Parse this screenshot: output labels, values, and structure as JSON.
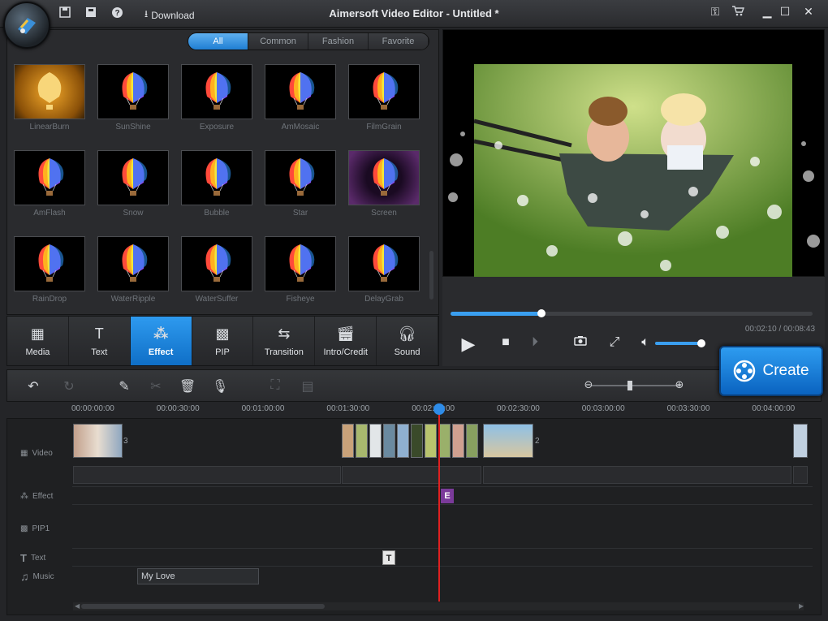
{
  "app": {
    "title": "Aimersoft Video Editor - Untitled *",
    "download_label": "Download"
  },
  "library": {
    "tabs": [
      {
        "label": "All",
        "active": true
      },
      {
        "label": "Common",
        "active": false
      },
      {
        "label": "Fashion",
        "active": false
      },
      {
        "label": "Favorite",
        "active": false
      }
    ],
    "effects": [
      {
        "label": "LinearBurn",
        "style": "gold"
      },
      {
        "label": "SunShine",
        "style": "dark"
      },
      {
        "label": "Exposure",
        "style": "dark"
      },
      {
        "label": "AmMosaic",
        "style": "dark"
      },
      {
        "label": "FilmGrain",
        "style": "dark"
      },
      {
        "label": "AmFlash",
        "style": "dark"
      },
      {
        "label": "Snow",
        "style": "dark"
      },
      {
        "label": "Bubble",
        "style": "dark"
      },
      {
        "label": "Star",
        "style": "dark"
      },
      {
        "label": "Screen",
        "style": "purple"
      },
      {
        "label": "RainDrop",
        "style": "dark"
      },
      {
        "label": "WaterRipple",
        "style": "dark"
      },
      {
        "label": "WaterSuffer",
        "style": "dark"
      },
      {
        "label": "Fisheye",
        "style": "dark"
      },
      {
        "label": "DelayGrab",
        "style": "dark"
      }
    ]
  },
  "toolbar": {
    "items": [
      {
        "label": "Media",
        "icon": "film-icon",
        "active": false
      },
      {
        "label": "Text",
        "icon": "text-icon",
        "active": false
      },
      {
        "label": "Effect",
        "icon": "magic-wand-icon",
        "active": true
      },
      {
        "label": "PIP",
        "icon": "pip-icon",
        "active": false
      },
      {
        "label": "Transition",
        "icon": "transition-icon",
        "active": false
      },
      {
        "label": "Intro/Credit",
        "icon": "clapper-icon",
        "active": false
      },
      {
        "label": "Sound",
        "icon": "headphones-icon",
        "active": false
      }
    ]
  },
  "player": {
    "time": "00:02:10 / 00:08:43",
    "progress": 0.25,
    "volume": 0.7
  },
  "create_label": "Create",
  "timeline": {
    "ruler": [
      "00:00:00:00",
      "00:00:30:00",
      "00:01:00:00",
      "00:01:30:00",
      "00:02:00:00",
      "00:02:30:00",
      "00:03:00:00",
      "00:03:30:00",
      "00:04:00:00"
    ],
    "tracks": {
      "video": "Video",
      "effect": "Effect",
      "pip": "PIP1",
      "text": "Text",
      "music": "Music"
    },
    "clip_counts": [
      "3",
      "2"
    ],
    "effect_marker": "E",
    "text_marker": "T",
    "music_clip": "My Love"
  },
  "colors": {
    "accent": "#1f7ed3",
    "playhead": "#e02020",
    "effect_marker": "#7a3a9a"
  }
}
